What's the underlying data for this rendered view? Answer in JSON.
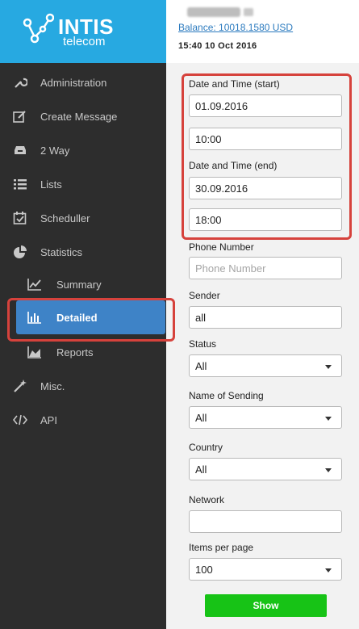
{
  "brand": {
    "title": "INTIS",
    "subtitle": "telecom",
    "color": "#27a9e1"
  },
  "header": {
    "balance": "Balance: 10018.1580 USD",
    "datetime": "15:40 10 Oct 2016"
  },
  "sidebar": {
    "items": [
      {
        "label": "Administration",
        "icon": "wrench-icon"
      },
      {
        "label": "Create Message",
        "icon": "edit-icon"
      },
      {
        "label": "2 Way",
        "icon": "inbox-icon"
      },
      {
        "label": "Lists",
        "icon": "list-icon"
      },
      {
        "label": "Scheduller",
        "icon": "calendar-icon"
      },
      {
        "label": "Statistics",
        "icon": "pie-chart-icon"
      },
      {
        "label": "Summary",
        "icon": "line-chart-icon"
      },
      {
        "label": "Detailed",
        "icon": "bar-chart-icon"
      },
      {
        "label": "Reports",
        "icon": "area-chart-icon"
      },
      {
        "label": "Misc.",
        "icon": "magic-wand-icon"
      },
      {
        "label": "API",
        "icon": "code-icon"
      }
    ],
    "active": "Detailed",
    "active_color": "#3e83c7"
  },
  "form": {
    "start_label": "Date and Time (start)",
    "start_date": "01.09.2016",
    "start_time": "10:00",
    "end_label": "Date and Time (end)",
    "end_date": "30.09.2016",
    "end_time": "18:00",
    "phone_label": "Phone Number",
    "phone_placeholder": "Phone Number",
    "sender_label": "Sender",
    "sender_value": "all",
    "status_label": "Status",
    "status_value": "All",
    "sending_label": "Name of Sending",
    "sending_value": "All",
    "country_label": "Country",
    "country_value": "All",
    "network_label": "Network",
    "network_value": "",
    "items_label": "Items per page",
    "items_value": "100",
    "show_button": "Show"
  },
  "colors": {
    "highlight": "#d6423c",
    "show_button": "#17c316"
  }
}
